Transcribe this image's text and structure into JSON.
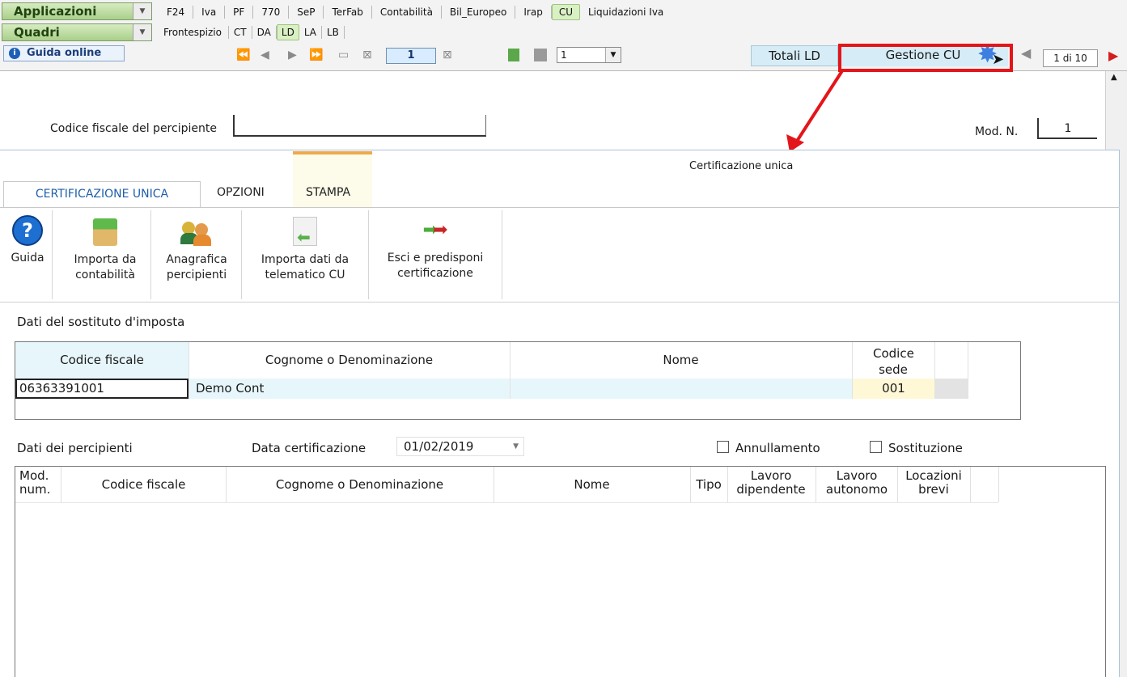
{
  "top_menu": {
    "applicazioni_label": "Applicazioni",
    "applicazioni_tabs": [
      "F24",
      "Iva",
      "PF",
      "770",
      "SeP",
      "TerFab",
      "Contabilità",
      "Bil_Europeo",
      "Irap",
      "CU",
      "Liquidazioni Iva"
    ],
    "applicazioni_selected": "CU",
    "quadri_label": "Quadri",
    "quadri_tabs": [
      "Frontespizio",
      "CT",
      "DA",
      "LD",
      "LA",
      "LB"
    ],
    "quadri_selected": "LD"
  },
  "toolbar": {
    "guida_online": "Guida online",
    "page_number": "1",
    "copy_select": "1",
    "totali_button": "Totali LD",
    "gestione_button": "Gestione CU",
    "pager": "1 di 10"
  },
  "form": {
    "cf_percipiente_label": "Codice fiscale del percipiente",
    "mod_n_label": "Mod. N.",
    "mod_n_value": "1"
  },
  "dialog": {
    "title": "Certificazione unica",
    "tabs": [
      "CERTIFICAZIONE UNICA",
      "OPZIONI",
      "STAMPA"
    ],
    "ribbon": {
      "guida": "Guida",
      "importa_contabilita": [
        "Importa da",
        "contabilità"
      ],
      "anagrafica": [
        "Anagrafica",
        "percipienti"
      ],
      "importa_telematico": [
        "Importa dati da",
        "telematico CU"
      ],
      "esci": [
        "Esci e predisponi",
        "certificazione"
      ]
    },
    "sostituto": {
      "section_label": "Dati del sostituto d'imposta",
      "headers": [
        "Codice fiscale",
        "Cognome o Denominazione",
        "Nome",
        "Codice sede"
      ],
      "row": {
        "codice_fiscale": "06363391001",
        "cognome": "Demo Cont",
        "nome": "",
        "codice_sede": "001"
      }
    },
    "percipienti": {
      "section_label": "Dati dei percipienti",
      "data_label": "Data certificazione",
      "data_value": "01/02/2019",
      "annullamento": "Annullamento",
      "sostituzione": "Sostituzione",
      "headers": [
        "Mod. num.",
        "Codice fiscale",
        "Cognome o Denominazione",
        "Nome",
        "Tipo",
        "Lavoro dipendente",
        "Lavoro autonomo",
        "Locazioni brevi"
      ]
    }
  },
  "colors": {
    "highlight_red": "#e4151a",
    "tab_green": "#a9cf8a",
    "button_blue": "#d6ecf7",
    "row_cyan": "#e7f6fb",
    "sede_yellow": "#fff8d6"
  }
}
